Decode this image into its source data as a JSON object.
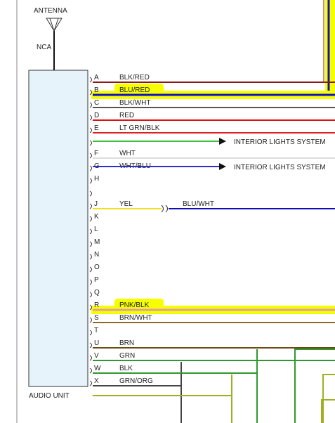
{
  "antenna": {
    "label": "ANTENNA",
    "wire_label": "NCA"
  },
  "audio_unit": {
    "label": "AUDIO UNIT"
  },
  "pins": [
    {
      "pin": "A",
      "wire": "BLK/RED",
      "color": "#8b1a1a",
      "long": true
    },
    {
      "pin": "B",
      "wire": "BLU/RED",
      "color": "#1010c8",
      "highlight": true,
      "long": true
    },
    {
      "pin": "C",
      "wire": "BLK/WHT",
      "color": "#555555",
      "long": true
    },
    {
      "pin": "D",
      "wire": "RED",
      "color": "#dd1111",
      "long": true
    },
    {
      "pin": "E",
      "wire": "LT GRN/BLK",
      "color": "#e02020",
      "long": true
    },
    {
      "pin": "",
      "wire": "",
      "color": "#3fc03f",
      "arrow": "INTERIOR LIGHTS SYSTEM"
    },
    {
      "pin": "F",
      "wire": "WHT",
      "color": "#dddddd",
      "long": true
    },
    {
      "pin": "G",
      "wire": "WHT/BLU",
      "color": "#2b2bd0",
      "arrow": "INTERIOR LIGHTS SYSTEM"
    },
    {
      "pin": "H",
      "wire": "",
      "color": ""
    },
    {
      "pin": "",
      "wire": "",
      "color": ""
    },
    {
      "pin": "J",
      "wire": "YEL",
      "color": "#f0e020",
      "connector_wire": "BLU/WHT",
      "connector_color": "#1010b0"
    },
    {
      "pin": "K",
      "wire": "",
      "color": ""
    },
    {
      "pin": "L",
      "wire": "",
      "color": ""
    },
    {
      "pin": "M",
      "wire": "",
      "color": ""
    },
    {
      "pin": "N",
      "wire": "",
      "color": ""
    },
    {
      "pin": "O",
      "wire": "",
      "color": ""
    },
    {
      "pin": "P",
      "wire": "",
      "color": ""
    },
    {
      "pin": "Q",
      "wire": "",
      "color": ""
    },
    {
      "pin": "R",
      "wire": "PNK/BLK",
      "color": "#e0a0a0",
      "highlight": true,
      "long": true
    },
    {
      "pin": "S",
      "wire": "BRN/WHT",
      "color": "#8b6a2b",
      "long": true
    },
    {
      "pin": "T",
      "wire": "",
      "color": ""
    },
    {
      "pin": "U",
      "wire": "BRN",
      "color": "#6b4a12",
      "long": true
    },
    {
      "pin": "V",
      "wire": "GRN",
      "color": "#2e9a2e",
      "route": "down1"
    },
    {
      "pin": "W",
      "wire": "BLK",
      "color": "#444444",
      "route": "down2"
    },
    {
      "pin": "X",
      "wire": "GRN/ORG",
      "color": "#a0b020",
      "route": "down3"
    }
  ],
  "colors": {
    "highlight": "#f6ff00",
    "outline": "#333333",
    "box_fill": "#e6f3fb"
  }
}
